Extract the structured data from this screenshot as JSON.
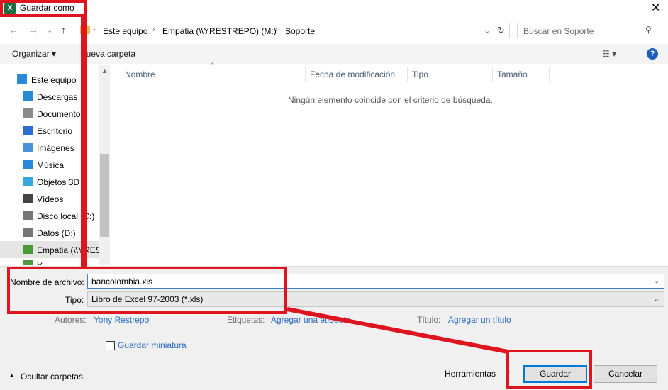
{
  "window": {
    "title": "Guardar como",
    "app_icon_letter": "X",
    "close_glyph": "✕"
  },
  "address": {
    "crumbs": [
      "Este equipo",
      "Empatia (\\\\YRESTREPO) (M:)",
      "Soporte"
    ],
    "search_placeholder": "Buscar en Soporte"
  },
  "toolbar": {
    "organize": "Organizar ▾",
    "new_folder": "Nueva carpeta"
  },
  "nav": {
    "items": [
      {
        "label": "Este equipo",
        "icon": "computer-icon",
        "color": "#2b88d8"
      },
      {
        "label": "Descargas",
        "icon": "download-icon",
        "color": "#2b88d8"
      },
      {
        "label": "Documentos",
        "icon": "document-icon",
        "color": "#8a8a8a"
      },
      {
        "label": "Escritorio",
        "icon": "desktop-icon",
        "color": "#2b6fd0"
      },
      {
        "label": "Imágenes",
        "icon": "image-icon",
        "color": "#4a90d9"
      },
      {
        "label": "Música",
        "icon": "music-icon",
        "color": "#2b88d8"
      },
      {
        "label": "Objetos 3D",
        "icon": "cube-icon",
        "color": "#35a8e0"
      },
      {
        "label": "Vídeos",
        "icon": "video-icon",
        "color": "#444444"
      },
      {
        "label": "Disco local (C:)",
        "icon": "drive-icon",
        "color": "#777777"
      },
      {
        "label": "Datos (D:)",
        "icon": "drive-icon",
        "color": "#777777"
      },
      {
        "label": "Empatia (\\\\YRES",
        "icon": "network-drive-icon",
        "color": "#4a9a3a"
      },
      {
        "label": "Y...",
        "icon": "network-drive-icon",
        "color": "#4a9a3a"
      }
    ]
  },
  "files": {
    "columns": [
      "Nombre",
      "Fecha de modificación",
      "Tipo",
      "Tamaño"
    ],
    "empty_message": "Ningún elemento coincide con el criterio de búsqueda."
  },
  "form": {
    "filename_label": "Nombre de archivo:",
    "filename_value": "bancolombia.xls",
    "type_label": "Tipo:",
    "type_value": "Libro de Excel 97-2003 (*.xls)",
    "authors_label": "Autores:",
    "authors_value": "Yony Restrepo",
    "tags_label": "Etiquetas:",
    "tags_value": "Agregar una etiqueta",
    "title_label": "Título:",
    "title_value": "Agregar un título",
    "thumbnail_label": "Guardar miniatura"
  },
  "footer": {
    "hide_folders": "Ocultar carpetas",
    "tools": "Herramientas",
    "save": "Guardar",
    "cancel": "Cancelar"
  },
  "colors": {
    "annotation_red": "#e0141e",
    "accent_blue": "#0078d7",
    "link_blue": "#2a6cc4"
  }
}
